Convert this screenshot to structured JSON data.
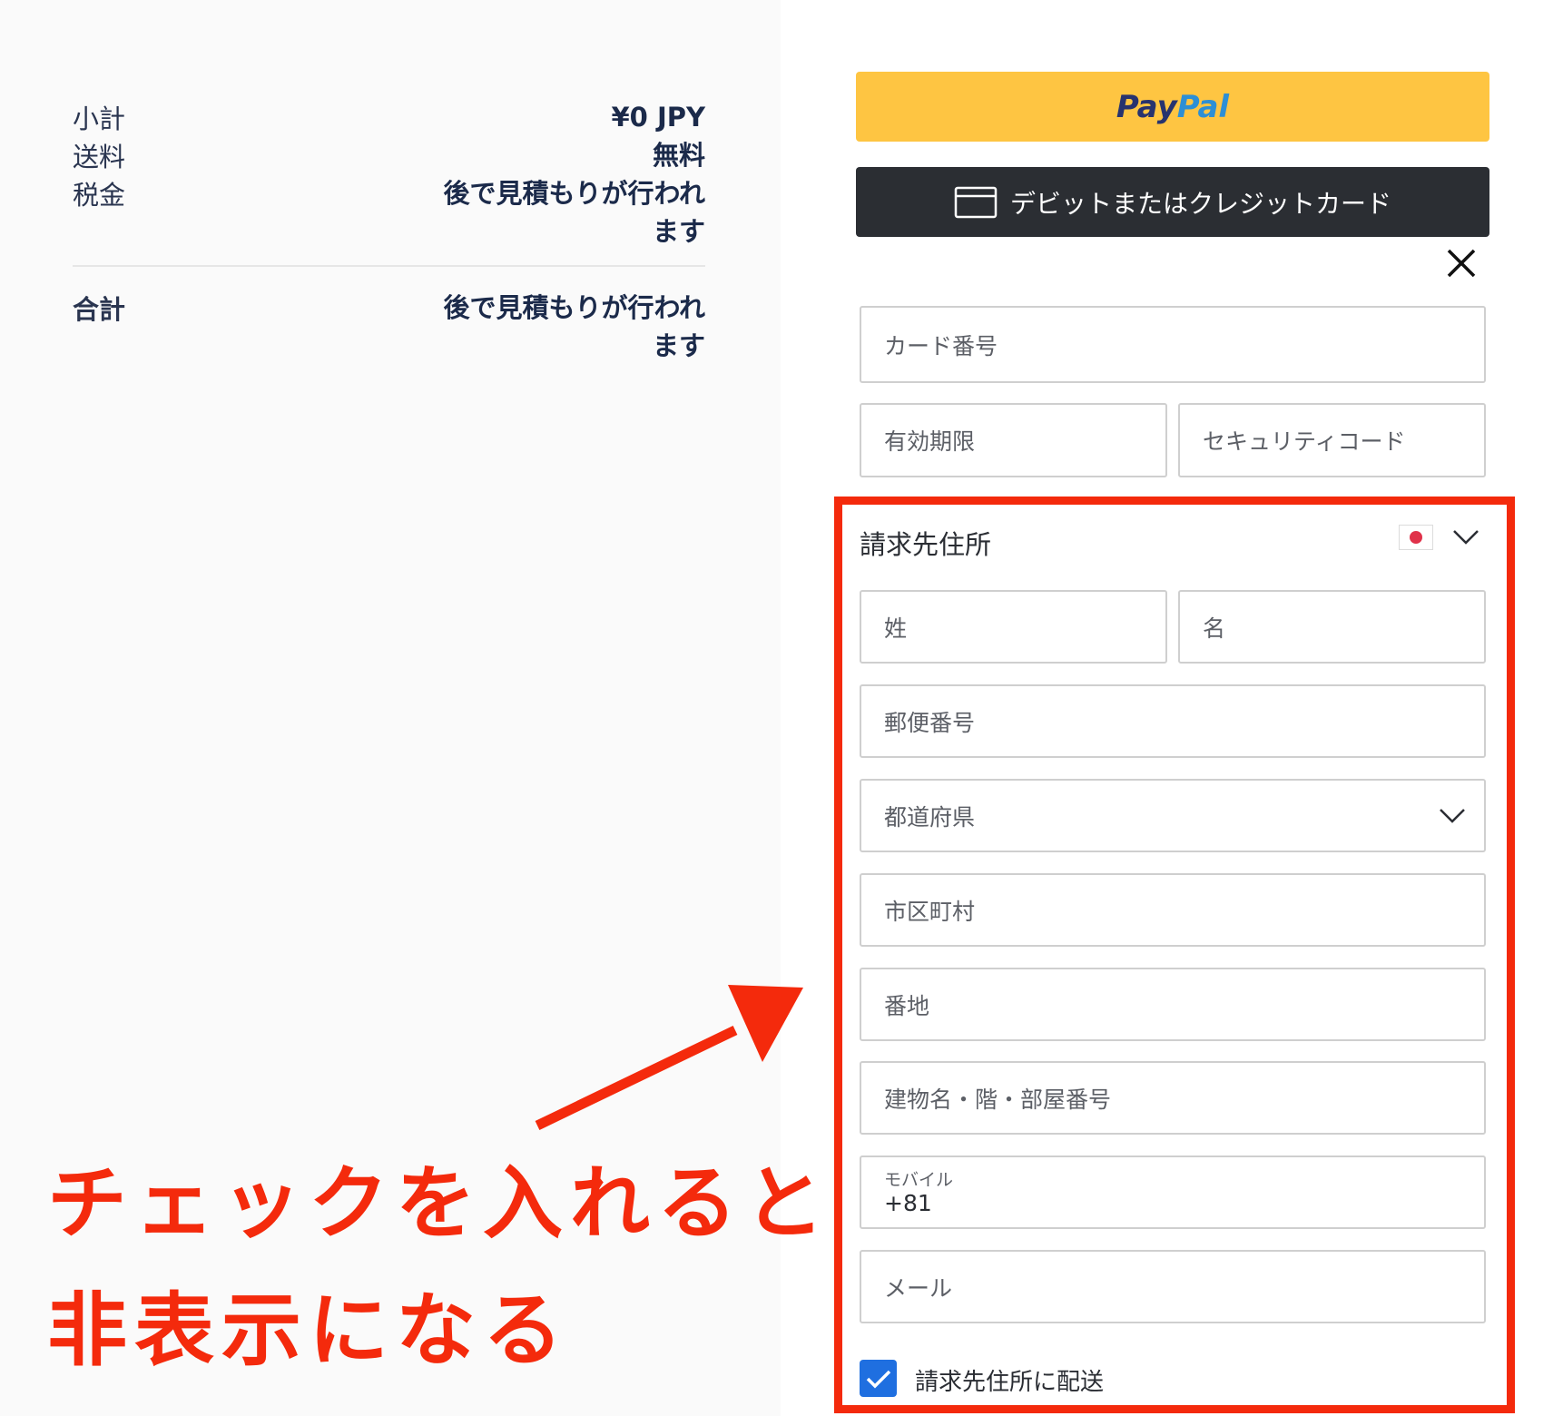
{
  "summary": {
    "subtotal_label": "小計",
    "subtotal_value": "¥0 JPY",
    "shipping_label": "送料",
    "shipping_value": "無料",
    "tax_label": "税金",
    "tax_value_line1": "後で見積もりが行われ",
    "tax_value_line2": "ます",
    "total_label": "合計",
    "total_value_line1": "後で見積もりが行われ",
    "total_value_line2": "ます"
  },
  "payment": {
    "paypal_logo_part1": "Pay",
    "paypal_logo_part2": "Pal",
    "card_button_label": "デビットまたはクレジットカード",
    "card_number_placeholder": "カード番号",
    "expiry_placeholder": "有効期限",
    "security_code_placeholder": "セキュリティコード"
  },
  "billing": {
    "title": "請求先住所",
    "last_name_placeholder": "姓",
    "first_name_placeholder": "名",
    "postal_code_placeholder": "郵便番号",
    "prefecture_placeholder": "都道府県",
    "city_placeholder": "市区町村",
    "street_placeholder": "番地",
    "building_placeholder": "建物名・階・部屋番号",
    "mobile_label": "モバイル",
    "mobile_value": "+81",
    "email_placeholder": "メール",
    "ship_to_billing_label": "請求先住所に配送",
    "ship_to_billing_checked": true
  },
  "annotation": {
    "line1": "チェックを入れると",
    "line2": "非表示になる",
    "color": "#f42a0c"
  },
  "colors": {
    "paypal_yellow": "#fec542",
    "card_button_dark": "#2b2e33",
    "checkbox_blue": "#1f6fe0"
  }
}
